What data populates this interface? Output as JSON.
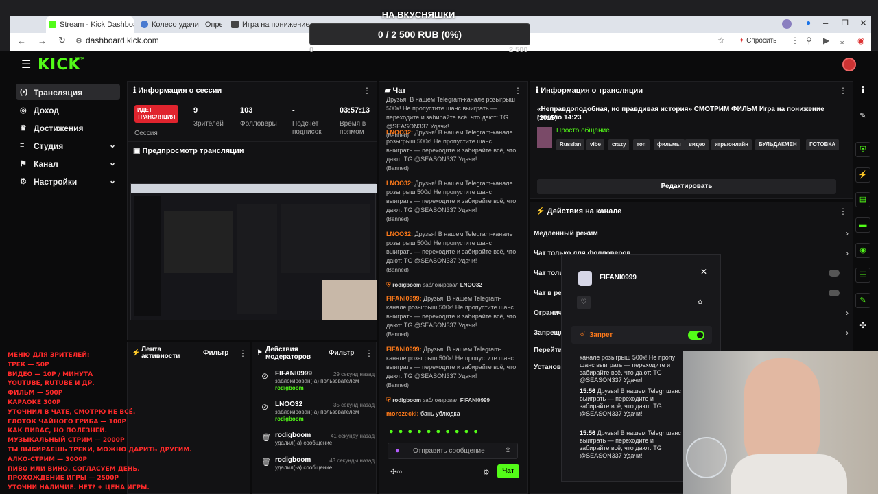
{
  "browser": {
    "tabs": [
      {
        "label": "Stream - Kick Dashboard"
      },
      {
        "label": "Колесо удачи | Определен"
      },
      {
        "label": "Игра на понижение"
      }
    ],
    "url": "dashboard.kick.com",
    "ask_label": "Спросить"
  },
  "goal": {
    "title": "НА ВКУСНЯШКИ",
    "progress_text": "0 / 2 500 RUB (0%)",
    "min": "0",
    "max": "2 500",
    "progress": 0
  },
  "brand": {
    "logo": "KICK",
    "badge": "BETA",
    "accent": "#53fc18"
  },
  "sidebar": {
    "items": [
      {
        "label": "Трансляция",
        "icon": "broadcast-icon"
      },
      {
        "label": "Доход",
        "icon": "coin-icon"
      },
      {
        "label": "Достижения",
        "icon": "trophy-icon"
      },
      {
        "label": "Студия",
        "icon": "sliders-icon"
      },
      {
        "label": "Канал",
        "icon": "flag-icon"
      },
      {
        "label": "Настройки",
        "icon": "gear-icon"
      }
    ]
  },
  "session": {
    "title": "Информация о сессии",
    "live_badge": "ИДЕТ ТРАНСЛЯЦИЯ",
    "session_label": "Сессия",
    "stats": [
      {
        "value": "9",
        "label": "Зрителей"
      },
      {
        "value": "103",
        "label": "Фолловеры"
      },
      {
        "value": "-",
        "label": "Подсчет подписок"
      },
      {
        "value": "03:57:13",
        "label": "Время в прямом"
      }
    ]
  },
  "preview": {
    "title": "Предпросмотр трансляции"
  },
  "activity": {
    "title": "Лента активности",
    "filter": "Фильтр"
  },
  "mod_actions": {
    "title": "Действия модераторов",
    "filter": "Фильтр",
    "items": [
      {
        "name": "FIFANI0999",
        "time": "29 секунд назад",
        "text": "заблокирован(-а) пользователем",
        "by": "rodigboom"
      },
      {
        "name": "LNOO32",
        "time": "35 секунд назад",
        "text": "заблокирован(-а) пользователем",
        "by": "rodigboom"
      },
      {
        "name": "rodigboom",
        "time": "41 секунду назад",
        "text": "удалил(-а) сообщение",
        "by": ""
      },
      {
        "name": "rodigboom",
        "time": "43 секунды назад",
        "text": "удалил(-а) сообщение",
        "by": ""
      }
    ]
  },
  "chat": {
    "title": "Чат",
    "spam_text": "Друзья! В нашем Telegram-канале розыгрыш 500к! Не пропустите шанс выиграть — переходите и забирайте всё, что дают: TG @SEASON337 Удачи!",
    "banned": "(Banned)",
    "messages": [
      {
        "user": "",
        "kind": "spam"
      },
      {
        "user": "LNOO32:",
        "kind": "spam"
      },
      {
        "user": "LNOO32:",
        "kind": "spam"
      },
      {
        "user": "LNOO32:",
        "kind": "spam"
      }
    ],
    "sys1": {
      "mod": "rodigboom",
      "text": "заблокировал",
      "target": "LNOO32"
    },
    "fifa_messages": [
      {
        "user": "FIFANI0999:"
      },
      {
        "user": "FIFANI0999:"
      }
    ],
    "sys2": {
      "mod": "rodigboom",
      "text": "заблокировал",
      "target": "FIFANI0999"
    },
    "last": {
      "user": "morozeckl:",
      "text": "бань ублюдка"
    },
    "input_placeholder": "Отправить сообщение",
    "send_label": "Чат"
  },
  "stream_info": {
    "title": "Информация о трансляции",
    "stream_title": "«Неправдоподобная, но правдивая история» СМОТРИМ ФИЛЬМ Игра на понижение (2015)",
    "start": "Начало 14:23",
    "category": "Просто общение",
    "tags": [
      "Russian",
      "vibe",
      "crazy",
      "топ",
      "фильмы",
      "видео",
      "игрыонлайн",
      "БУЛЬДАКМЕН",
      "ГОТОВКА"
    ],
    "edit_label": "Редактировать"
  },
  "channel_actions": {
    "title": "Действия на канале",
    "items": [
      {
        "label": "Медленный режим"
      },
      {
        "label": "Чат только для фолловеров"
      },
      {
        "label": "Чат толь"
      },
      {
        "label": "Чат в реж"
      },
      {
        "label": "Огранич"
      },
      {
        "label": "Запреще"
      },
      {
        "label": "Перейти"
      },
      {
        "label": "Установ"
      }
    ]
  },
  "user_popup": {
    "name": "FIFANI0999",
    "ban_label": "Запрет",
    "messages": [
      {
        "time": "",
        "text": "канале розыгрыш 500к! Не пропу шанс выиграть — переходите и забирайте всё, что дают: TG @SEASON337 Удачи!"
      },
      {
        "time": "15:56",
        "text": "Друзья! В нашем Telegr шанс выиграть — переходите и забирайте всё, что дают: TG @SEASON337 Удачи!"
      },
      {
        "time": "15:56",
        "text": "Друзья! В нашем Telegr шанс выиграть — переходите и забирайте всё, что дают: TG @SEASON337 Удачи!"
      }
    ]
  },
  "overlay_menu": [
    "МЕНЮ ДЛЯ ЗРИТЕЛЕЙ:",
    "ТРЕК — 50Р",
    "ВИДЕО — 10Р / МИНУТА",
    "YOUTUBE, RUTUBE И ДР.",
    "ФИЛЬМ — 500Р",
    "КАРАОКЕ 300Р",
    "УТОЧНИЛ В ЧАТЕ, СМОТРЮ НЕ ВСЁ.",
    "ГЛОТОК ЧАЙНОГО ГРИБА — 100Р",
    "КАК ПИВАС, НО ПОЛЕЗНЕЙ.",
    "МУЗЫКАЛЬНЫЙ СТРИМ — 2000Р",
    "ТЫ ВЫБИРАЕШЬ ТРЕКИ, МОЖНО ДАРИТЬ ДРУГИМ.",
    "АЛКО-СТРИМ — 3000Р",
    "ПИВО ИЛИ ВИНО. СОГЛАСУЕМ ДЕНЬ.",
    "ПРОХОЖДЕНИЕ ИГРЫ — 2500Р",
    "УТОЧНИ НАЛИЧИЕ. НЕТ? + ЦЕНА ИГРЫ."
  ]
}
